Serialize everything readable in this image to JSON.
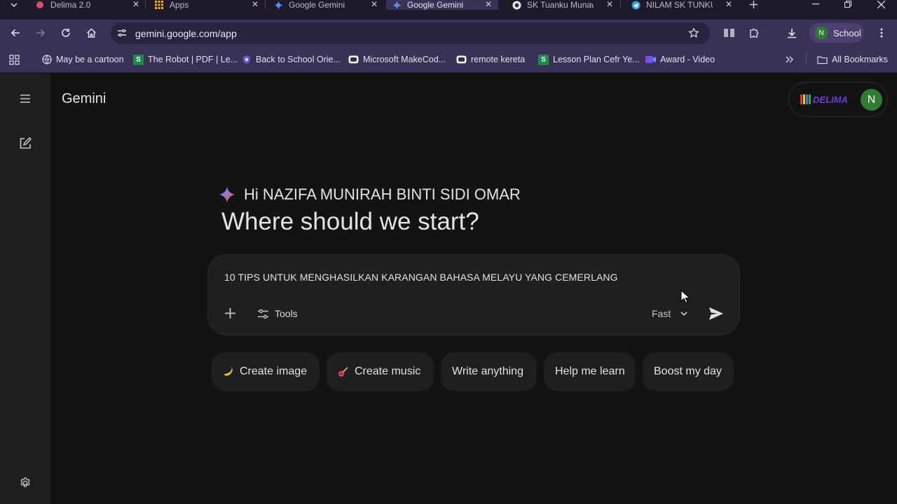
{
  "browser": {
    "tabs": [
      {
        "label": "Delima 2.0",
        "icon": "delima-favicon",
        "active": false
      },
      {
        "label": "Apps",
        "icon": "apps-grid-favicon",
        "active": false
      },
      {
        "label": "Google Gemini",
        "icon": "gemini-favicon",
        "active": false
      },
      {
        "label": "Google Gemini",
        "icon": "gemini-favicon",
        "active": true
      },
      {
        "label": "SK Tuanku Munaw",
        "icon": "school-favicon",
        "active": false
      },
      {
        "label": "NILAM SK TUNKU",
        "icon": "telegram-favicon",
        "active": false
      }
    ],
    "url": "gemini.google.com/app",
    "profile": {
      "initial": "N",
      "label": "School"
    },
    "bookmarks": [
      {
        "label": "May be a cartoon",
        "icon": "globe-icon"
      },
      {
        "label": "The Robot | PDF | Le...",
        "icon": "s-doc-icon"
      },
      {
        "label": "Back to School Orie...",
        "icon": "shield-icon"
      },
      {
        "label": "Microsoft MakeCod...",
        "icon": "makecode-icon"
      },
      {
        "label": "remote kereta",
        "icon": "makecode-icon"
      },
      {
        "label": "Lesson Plan Cefr Ye...",
        "icon": "s-doc-icon"
      },
      {
        "label": "Award - Video",
        "icon": "video-icon"
      }
    ],
    "all_bookmarks_label": "All Bookmarks"
  },
  "app": {
    "title": "Gemini",
    "account_initial": "N",
    "logo_text": "DELIMA"
  },
  "main": {
    "greeting": "Hi NAZIFA MUNIRAH BINTI SIDI OMAR",
    "headline": "Where should we start?",
    "prompt_value": "10 TIPS UNTUK MENGHASILKAN KARANGAN BAHASA MELAYU YANG CEMERLANG",
    "tools_label": "Tools",
    "mode_label": "Fast",
    "chips": [
      {
        "label": "Create image",
        "icon": "banana-icon"
      },
      {
        "label": "Create music",
        "icon": "guitar-icon"
      },
      {
        "label": "Write anything",
        "icon": ""
      },
      {
        "label": "Help me learn",
        "icon": ""
      },
      {
        "label": "Boost my day",
        "icon": ""
      }
    ]
  },
  "colors": {
    "background": "#131314",
    "surface": "#1e1f20",
    "browser_chrome": "#3a3157",
    "text": "#e3e3e3"
  }
}
